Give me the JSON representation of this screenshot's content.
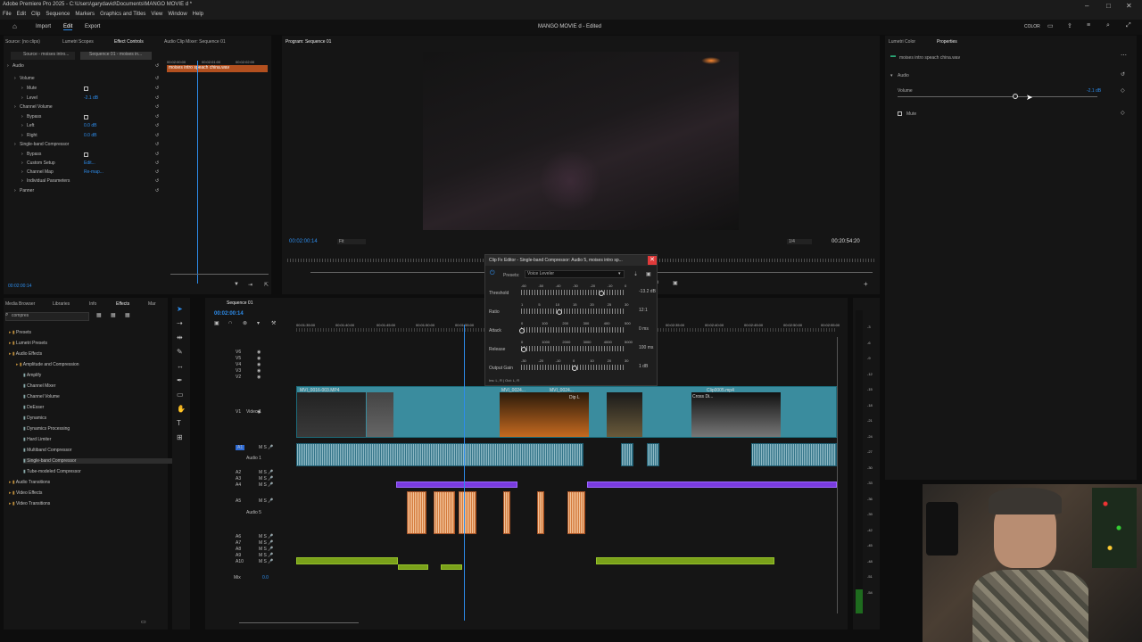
{
  "window": {
    "title": "Adobe Premiere Pro 2025 - C:\\Users\\garydavid\\Documents\\MANGO MOVIE d *",
    "controls": [
      "–",
      "□",
      "✕"
    ]
  },
  "menu": [
    "File",
    "Edit",
    "Clip",
    "Sequence",
    "Markers",
    "Graphics and Titles",
    "View",
    "Window",
    "Help"
  ],
  "header": {
    "nav": [
      "Import",
      "Edit",
      "Export"
    ],
    "project_title": "MANGO MOVIE d - Edited",
    "color_label": "COLOR"
  },
  "left_panel": {
    "tabs": [
      "Source: (no clips)",
      "Lumetri Scopes",
      "Effect Controls",
      "Audio Clip Mixer: Sequence 01"
    ],
    "source_tab": "Source - moises intro...",
    "seq_tab": "Sequence 01 - moises in...",
    "ruler": [
      "00:02:00:00",
      "00:02:01:00",
      "00:02:02:00"
    ],
    "clip_name": "moises intro speach china.wav",
    "rows": [
      {
        "label": "Audio",
        "value": ""
      },
      {
        "label": "Volume",
        "value": ""
      },
      {
        "label": "Mute",
        "value": ""
      },
      {
        "label": "Level",
        "value": "-2.1 dB"
      },
      {
        "label": "Channel Volume",
        "value": ""
      },
      {
        "label": "Bypass",
        "value": ""
      },
      {
        "label": "Left",
        "value": "0.0 dB"
      },
      {
        "label": "Right",
        "value": "0.0 dB"
      },
      {
        "label": "Single-band Compressor",
        "value": ""
      },
      {
        "label": "Bypass",
        "value": ""
      },
      {
        "label": "Custom Setup",
        "value": "Edit..."
      },
      {
        "label": "Channel Map",
        "value": "Re-map..."
      },
      {
        "label": "Individual Parameters",
        "value": ""
      },
      {
        "label": "Panner",
        "value": ""
      }
    ],
    "timecode": "00:02:00:14"
  },
  "program": {
    "tab": "Program: Sequence 01",
    "timecode": "00:02:00:14",
    "fit": "Fit",
    "quality": "1/4",
    "duration": "00:20:54:20"
  },
  "properties": {
    "tabs": [
      "Lumetri Color",
      "Properties"
    ],
    "clip_name": "moises intro speach china.wav",
    "section": "Audio",
    "volume_label": "Volume",
    "volume_value": "-2.1 dB",
    "mute_label": "Mute"
  },
  "effects_panel": {
    "tabs": [
      "Media Browser",
      "Libraries",
      "Info",
      "Effects",
      "Mar"
    ],
    "search_value": "compres",
    "tree": [
      {
        "label": "Presets",
        "level": 0
      },
      {
        "label": "Lumetri Presets",
        "level": 0
      },
      {
        "label": "Audio Effects",
        "level": 0
      },
      {
        "label": "Amplitude and Compression",
        "level": 1
      },
      {
        "label": "Amplify",
        "level": 2
      },
      {
        "label": "Channel Mixer",
        "level": 2
      },
      {
        "label": "Channel Volume",
        "level": 2
      },
      {
        "label": "DeEsser",
        "level": 2
      },
      {
        "label": "Dynamics",
        "level": 2
      },
      {
        "label": "Dynamics Processing",
        "level": 2
      },
      {
        "label": "Hard Limiter",
        "level": 2
      },
      {
        "label": "Multiband Compressor",
        "level": 2
      },
      {
        "label": "Single-band Compressor",
        "level": 2
      },
      {
        "label": "Tube-modeled Compressor",
        "level": 2
      },
      {
        "label": "Audio Transitions",
        "level": 0
      },
      {
        "label": "Video Effects",
        "level": 0
      },
      {
        "label": "Video Transitions",
        "level": 0
      }
    ]
  },
  "timeline": {
    "tab": "Sequence 01",
    "timecode": "00:02:00:14",
    "ruler": [
      "00:01:35:00",
      "00:01:40:00",
      "00:01:45:00",
      "00:01:50:00",
      "00:01:55:00",
      "00:02:00:00",
      "00:02:35:00",
      "00:02:40:00",
      "00:02:45:00",
      "00:02:50:00",
      "00:02:55:00",
      "00:03:00:00"
    ],
    "tracks_v": [
      "V6",
      "V5",
      "V4",
      "V3",
      "V2",
      "V1"
    ],
    "tracks_a": [
      "A1",
      "A2",
      "A3",
      "A4",
      "A5",
      "A6",
      "A7",
      "A8",
      "A9",
      "A10"
    ],
    "v1_label": "Video 1",
    "a1_label": "Audio 1",
    "a5_label": "Audio 5",
    "mix_label": "Mix",
    "mix_value": "0.0",
    "clips": [
      "MVI_0016-003.MP4",
      "MVI_0024...",
      "MVI_0024...",
      "Dip L",
      "Clip0005.mp4",
      "Cross Di..."
    ],
    "meter": [
      "-3",
      "-6",
      "-9",
      "-12",
      "-15",
      "-18",
      "-21",
      "-24",
      "-27",
      "-30",
      "-33",
      "-36",
      "-39",
      "-42",
      "-45",
      "-48",
      "-51",
      "-54"
    ]
  },
  "dialog": {
    "title": "Clip Fx Editor - Single-band Compressor: Audio 5, moises intro sp...",
    "presets_label": "Presets:",
    "preset_value": "Voice Leveler",
    "params": [
      {
        "label": "Threshold",
        "scale": [
          "-60",
          "-50",
          "-40",
          "-30",
          "-20",
          "-10",
          "0"
        ],
        "value": "-13.2 dB",
        "pos": 0.77
      },
      {
        "label": "Ratio",
        "scale": [
          "1",
          "5",
          "10",
          "15",
          "20",
          "25",
          "30"
        ],
        "value": "12:1",
        "pos": 0.36
      },
      {
        "label": "Attack",
        "scale": [
          "0",
          "100",
          "200",
          "300",
          "400",
          "500"
        ],
        "value": "0 ms",
        "pos": 0.0
      },
      {
        "label": "Release",
        "scale": [
          "0",
          "1000",
          "2000",
          "3000",
          "4000",
          "5000"
        ],
        "value": "100 ms",
        "pos": 0.02
      },
      {
        "label": "Output Gain",
        "scale": [
          "-30",
          "-20",
          "-10",
          "0",
          "10",
          "20",
          "30"
        ],
        "value": "1 dB",
        "pos": 0.51
      }
    ],
    "io": "Ins: L, R | Out: L, R"
  },
  "colors": {
    "accent": "#2d8ceb",
    "video_clip": "#3a8c9e",
    "orange_clip": "#d37a3b",
    "purple_clip": "#7a3be0",
    "green_clip": "#7aa11a",
    "close_btn": "#e03a3a"
  }
}
